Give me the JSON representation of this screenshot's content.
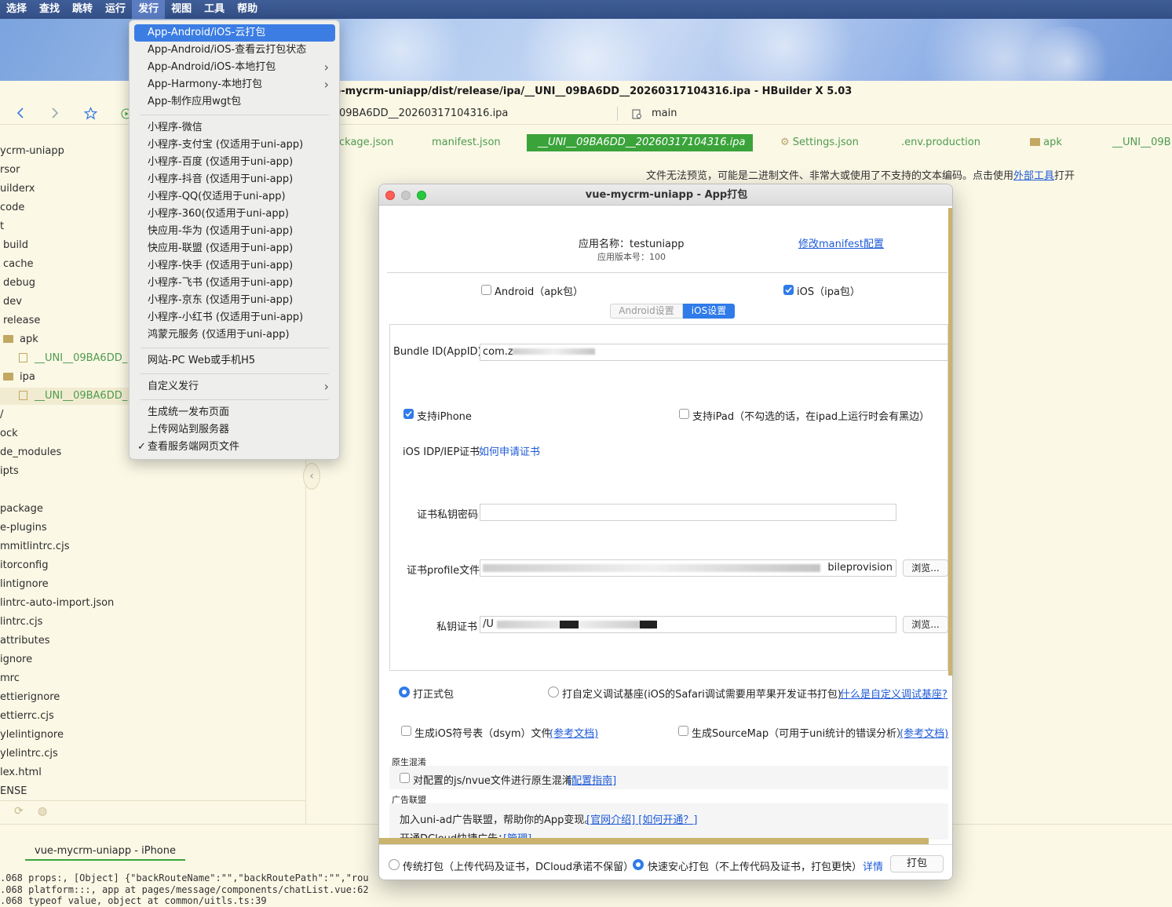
{
  "menubar": [
    "选择",
    "查找",
    "跳转",
    "运行",
    "发行",
    "视图",
    "工具",
    "帮助"
  ],
  "window_title": "vue-mycrm-uniapp/dist/release/ipa/__UNI__09BA6DD__20260317104316.ipa - HBuilder X 5.03",
  "address": {
    "file": "09BA6DD__20260317104316.ipa",
    "branch": "main"
  },
  "tabs": [
    "ckage.json",
    "manifest.json",
    "__UNI__09BA6DD__20260317104316.ipa",
    "Settings.json",
    ".env.production",
    "apk",
    "__UNI__09B"
  ],
  "preview_notice": {
    "text": "文件无法预览，可能是二进制文件、非常大或使用了不支持的文本编码。点击使用",
    "link": "外部工具",
    "suffix": "打开"
  },
  "sidebar": [
    "ycrm-uniapp",
    "rsor",
    "uilderx",
    "code",
    "t",
    "build",
    "cache",
    "debug",
    "dev",
    "release",
    "apk",
    "__UNI__09BA6DD_",
    "ipa",
    "__UNI__09BA6DD_",
    "/",
    "ock",
    "de_modules",
    "ipts",
    "",
    "package",
    "e-plugins",
    "mmitlintrc.cjs",
    "itorconfig",
    "lintignore",
    "lintrc-auto-import.json",
    "lintrc.cjs",
    "attributes",
    "ignore",
    "mrc",
    "ettierignore",
    "ettierrc.cjs",
    "ylelintignore",
    "ylelintrc.cjs",
    "lex.html",
    "ENSE"
  ],
  "menu": {
    "items": [
      {
        "label": "App-Android/iOS-云打包",
        "selected": true
      },
      {
        "label": "App-Android/iOS-查看云打包状态"
      },
      {
        "label": "App-Android/iOS-本地打包",
        "submenu": true
      },
      {
        "label": "App-Harmony-本地打包",
        "submenu": true
      },
      {
        "label": "App-制作应用wgt包"
      },
      {
        "label": "小程序-微信"
      },
      {
        "label": "小程序-支付宝 (仅适用于uni-app)"
      },
      {
        "label": "小程序-百度 (仅适用于uni-app)"
      },
      {
        "label": "小程序-抖音 (仅适用于uni-app)"
      },
      {
        "label": "小程序-QQ(仅适用于uni-app)"
      },
      {
        "label": "小程序-360(仅适用于uni-app)"
      },
      {
        "label": "快应用-华为 (仅适用于uni-app)"
      },
      {
        "label": "快应用-联盟 (仅适用于uni-app)"
      },
      {
        "label": "小程序-快手 (仅适用于uni-app)"
      },
      {
        "label": "小程序-飞书 (仅适用于uni-app)"
      },
      {
        "label": "小程序-京东 (仅适用于uni-app)"
      },
      {
        "label": "小程序-小红书 (仅适用于uni-app)"
      },
      {
        "label": "鸿蒙元服务 (仅适用于uni-app)"
      },
      {
        "label": "网站-PC Web或手机H5"
      },
      {
        "label": "自定义发行",
        "submenu": true
      },
      {
        "label": "生成统一发布页面"
      },
      {
        "label": "上传网站到服务器"
      },
      {
        "label": "查看服务端网页文件",
        "checked": true
      }
    ]
  },
  "dialog": {
    "title": "vue-mycrm-uniapp - App打包",
    "app_name_label": "应用名称：testuniapp",
    "app_version": "应用版本号：100",
    "edit_manifest": "修改manifest配置",
    "android_check": "Android（apk包）",
    "ios_check": "iOS（ipa包）",
    "tab_android": "Android设置",
    "tab_ios": "iOS设置",
    "bundle_label": "Bundle ID(AppID)",
    "bundle_value": "com.z",
    "support_iphone": "支持iPhone",
    "support_ipad": "支持iPad（不勾选的话，在ipad上运行时会有黑边）",
    "cert_label": "iOS IDP/IEP证书",
    "cert_link": "如何申请证书",
    "key_password_label": "证书私钥密码",
    "profile_label": "证书profile文件",
    "profile_value": "",
    "profile_suffix": "bileprovision",
    "private_key_label": "私钥证书",
    "private_key_value": "/U",
    "browse": "浏览...",
    "radio_formal": "打正式包",
    "radio_custom": "打自定义调试基座(iOS的Safari调试需要用苹果开发证书打包)",
    "custom_link": "什么是自定义调试基座?",
    "dsym": "生成iOS符号表（dsym）文件",
    "dsym_link": "(参考文档)",
    "sourcemap": "生成SourceMap（可用于uni统计的错误分析）",
    "sourcemap_link": "(参考文档)",
    "obf_section": "原生混淆",
    "obf_text": "对配置的js/nvue文件进行原生混淆",
    "obf_link": "[配置指南]",
    "ad_section": "广告联盟",
    "ad_text": "加入uni-ad广告联盟，帮助你的App变现。",
    "ad_link": "[官网介绍] [如何开通？]",
    "ad_text2": "开通DCloud快捷广告：",
    "ad_link2": "[管理]",
    "traditional": "传统打包（上传代码及证书，DCloud承诺不保留）",
    "fast": "快速安心打包（不上传代码及证书，打包更快）",
    "detail": "详情",
    "pack": "打包"
  },
  "bottom": {
    "tab": "vue-mycrm-uniapp - iPhone",
    "lines": [
      ".068 props:,  [Object] {\"backRouteName\":\"\",\"backRoutePath\":\"\",\"rou",
      ".068 platform:::,  app at pages/message/components/chatList.vue:62",
      ".068 typeof value,  object at common/uitls.ts:39"
    ]
  }
}
